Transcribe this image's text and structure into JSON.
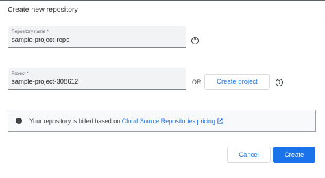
{
  "dialog": {
    "title": "Create new repository"
  },
  "repository_field": {
    "label": "Repository name *",
    "value": "sample-project-repo",
    "help_icon": "help-circle-icon"
  },
  "project_field": {
    "label": "Project *",
    "value": "sample-project-308612",
    "help_icon": "help-circle-icon"
  },
  "or_text": "OR",
  "create_project_button": "Create project",
  "info": {
    "icon": "info-icon",
    "text_prefix": "Your repository is billed based on",
    "link_text": "Cloud Source Repositories pricing",
    "link_icon": "open-in-new-icon",
    "text_suffix": "."
  },
  "actions": {
    "cancel_label": "Cancel",
    "create_label": "Create"
  },
  "colors": {
    "accent": "#1a73e8",
    "field_background": "#f1f3f4",
    "info_background": "#f8f9fa"
  }
}
